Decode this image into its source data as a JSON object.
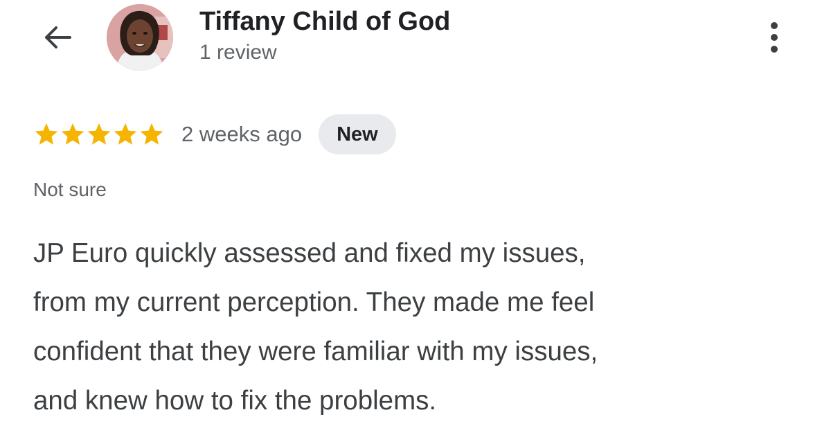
{
  "header": {
    "back_icon": "arrow-left-icon",
    "avatar_icon": "profile-photo",
    "user_name": "Tiffany Child of God",
    "review_count": "1 review",
    "more_icon": "more-vertical-icon"
  },
  "review": {
    "rating": 5,
    "rating_max": 5,
    "star_color": "#F4B400",
    "time_ago": "2 weeks ago",
    "badge": "New",
    "label": "Not sure",
    "text_lines": [
      "JP Euro quickly assessed and fixed my issues,",
      "from my current perception. They made me feel",
      "confident that they were familiar with my issues,",
      "and knew how to fix the problems."
    ]
  }
}
